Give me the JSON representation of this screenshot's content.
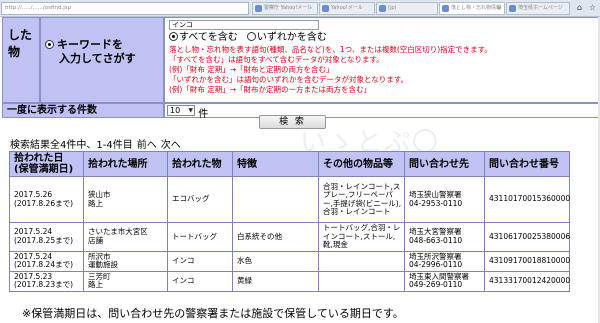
{
  "browser": {
    "address": "http://...../....../osfind.jsp",
    "tabs": [
      {
        "label": "警察庁 Yahoo!メール"
      },
      {
        "label": "Yahoo!メール"
      },
      {
        "label": "(jp)"
      },
      {
        "label": "落とし物・忘れ物情報",
        "active": true
      },
      {
        "label": "埼玉県ホームページ"
      }
    ]
  },
  "search": {
    "category_label": "した物",
    "keyword_label_line1": "キーワードを",
    "keyword_label_line2": "入力してさがす",
    "keyword_value": "インコ",
    "mode_all": "すべてを含む",
    "mode_any": "いずれかを含む",
    "mode_selected": "all",
    "notes": [
      "落とし物・忘れ物を表す語句(種類、品名など)を、1つ、または複数(空白区切り)指定できます。",
      "「すべてを含む」は語句をすべて含むデータが対象となります。",
      "(例)「財布 定期」→「財布と定期の両方を含む」",
      "「いずれかを含む」は語句のいずれかを含むデータが対象となります。",
      "(例)「財布 定期」→「財布か定期の一方または両方を含む」"
    ]
  },
  "display_count": {
    "label": "一度に表示する件数",
    "value": "10",
    "unit": "件"
  },
  "search_button": "検 索",
  "watermark": "いゝとぷ〇",
  "summary": {
    "text": "検索結果全4件中、1-4件目",
    "prev": "前へ",
    "next": "次へ"
  },
  "results": {
    "headers": [
      "拾われた日\n(保管満期日)",
      "拾われた場所",
      "拾われた物",
      "特徴",
      "その他の物品等",
      "問い合わせ先",
      "問い合わせ番号"
    ],
    "rows": [
      {
        "date": "2017.5.26\n(2017.8.26まで)",
        "place": "狭山市\n路上",
        "item": "エコバッグ",
        "feature": "",
        "other": "合羽・レインコート,スプレー,フリーペーパー,手提げ袋(ビニール),合羽・レインコート",
        "contact": "埼玉狭山警察署\n04-2953-0110",
        "number": "43110170015360000"
      },
      {
        "date": "2017.5.24\n(2017.8.25まで)",
        "place": "さいたま市大宮区\n店舗",
        "item": "トートバッグ",
        "feature": "白系統その他",
        "other": "トートバッグ,合羽・レインコート,ストール,靴,現金",
        "contact": "埼玉大宮警察署\n048-663-0110",
        "number": "43106170025380006"
      },
      {
        "date": "2017.5.24\n(2017.8.24まで)",
        "place": "所沢市\n運動施設",
        "item": "インコ",
        "feature": "水色",
        "other": "",
        "contact": "埼玉所沢警察署\n04-2996-0110",
        "number": "43109170018810000"
      },
      {
        "date": "2017.5.23\n(2017.8.23まで)",
        "place": "三芳町\n路上",
        "item": "インコ",
        "feature": "黄緑",
        "other": "",
        "contact": "埼玉東入間警察署\n049-269-0110",
        "number": "43133170012420000"
      }
    ]
  },
  "footnote": "※保管満期日は、問い合わせ先の警察署または施設で保管している期日です。"
}
